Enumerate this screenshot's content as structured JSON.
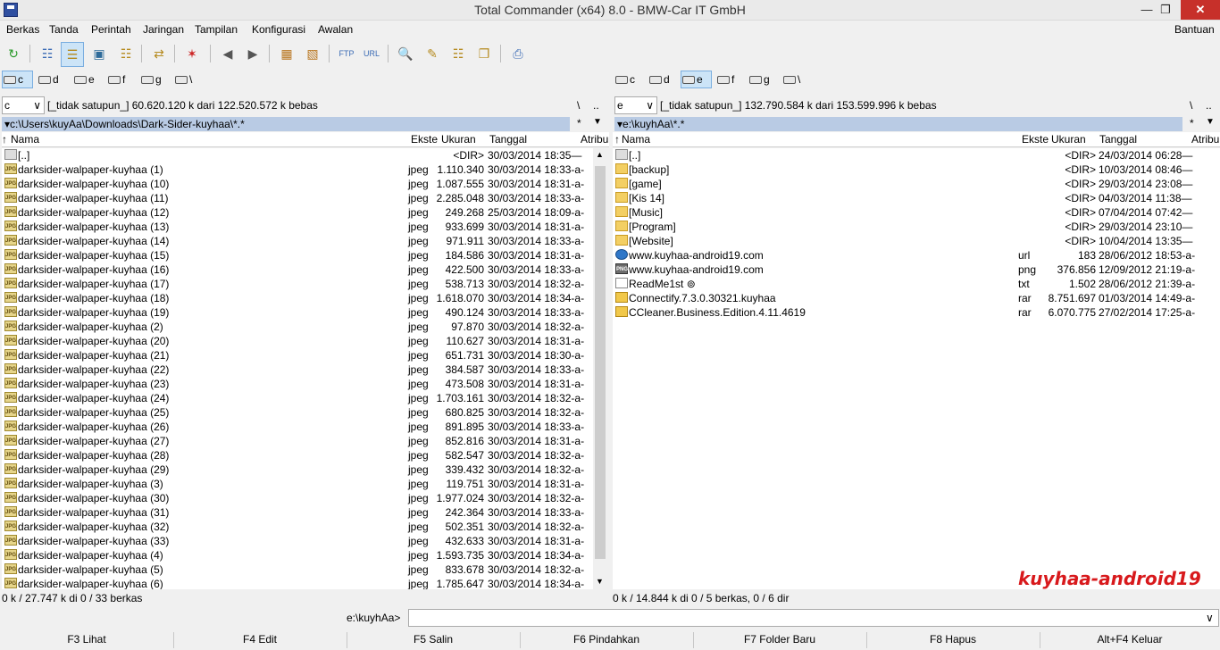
{
  "window": {
    "title": "Total Commander (x64) 8.0 - BMW-Car IT GmbH",
    "min": "—",
    "max": "❐",
    "close": "✕"
  },
  "menu": {
    "items": [
      "Berkas",
      "Tanda",
      "Perintah",
      "Jaringan",
      "Tampilan",
      "Konfigurasi",
      "Awalan"
    ],
    "help": "Bantuan"
  },
  "left": {
    "drives": [
      "c",
      "d",
      "e",
      "f",
      "g",
      "\\"
    ],
    "active_drive": "c",
    "combo": "c",
    "info": "[_tidak satupun_]  60.620.120 k dari 122.520.572 k bebas",
    "root_btn": "\\",
    "parent_btn": "..",
    "path": "c:\\Users\\kuyAa\\Downloads\\Dark-Sider-kuyhaa\\*.*",
    "star": "*",
    "cols": {
      "name": "Nama",
      "ext": "Ekste",
      "size": "Ukuran",
      "date": "Tanggal",
      "attr": "Atribu"
    },
    "rows": [
      {
        "icon": "up",
        "name": "[..]",
        "ext": "",
        "size": "<DIR>",
        "date": "30/03/2014 18:35—"
      },
      {
        "icon": "jpg",
        "name": "darksider-walpaper-kuyhaa (1)",
        "ext": "jpeg",
        "size": "1.110.340",
        "date": "30/03/2014 18:33-a-"
      },
      {
        "icon": "jpg",
        "name": "darksider-walpaper-kuyhaa (10)",
        "ext": "jpeg",
        "size": "1.087.555",
        "date": "30/03/2014 18:31-a-"
      },
      {
        "icon": "jpg",
        "name": "darksider-walpaper-kuyhaa (11)",
        "ext": "jpeg",
        "size": "2.285.048",
        "date": "30/03/2014 18:33-a-"
      },
      {
        "icon": "jpg",
        "name": "darksider-walpaper-kuyhaa (12)",
        "ext": "jpeg",
        "size": "249.268",
        "date": "25/03/2014 18:09-a-"
      },
      {
        "icon": "jpg",
        "name": "darksider-walpaper-kuyhaa (13)",
        "ext": "jpeg",
        "size": "933.699",
        "date": "30/03/2014 18:31-a-"
      },
      {
        "icon": "jpg",
        "name": "darksider-walpaper-kuyhaa (14)",
        "ext": "jpeg",
        "size": "971.911",
        "date": "30/03/2014 18:33-a-"
      },
      {
        "icon": "jpg",
        "name": "darksider-walpaper-kuyhaa (15)",
        "ext": "jpeg",
        "size": "184.586",
        "date": "30/03/2014 18:31-a-"
      },
      {
        "icon": "jpg",
        "name": "darksider-walpaper-kuyhaa (16)",
        "ext": "jpeg",
        "size": "422.500",
        "date": "30/03/2014 18:33-a-"
      },
      {
        "icon": "jpg",
        "name": "darksider-walpaper-kuyhaa (17)",
        "ext": "jpeg",
        "size": "538.713",
        "date": "30/03/2014 18:32-a-"
      },
      {
        "icon": "jpg",
        "name": "darksider-walpaper-kuyhaa (18)",
        "ext": "jpeg",
        "size": "1.618.070",
        "date": "30/03/2014 18:34-a-"
      },
      {
        "icon": "jpg",
        "name": "darksider-walpaper-kuyhaa (19)",
        "ext": "jpeg",
        "size": "490.124",
        "date": "30/03/2014 18:33-a-"
      },
      {
        "icon": "jpg",
        "name": "darksider-walpaper-kuyhaa (2)",
        "ext": "jpeg",
        "size": "97.870",
        "date": "30/03/2014 18:32-a-"
      },
      {
        "icon": "jpg",
        "name": "darksider-walpaper-kuyhaa (20)",
        "ext": "jpeg",
        "size": "110.627",
        "date": "30/03/2014 18:31-a-"
      },
      {
        "icon": "jpg",
        "name": "darksider-walpaper-kuyhaa (21)",
        "ext": "jpeg",
        "size": "651.731",
        "date": "30/03/2014 18:30-a-"
      },
      {
        "icon": "jpg",
        "name": "darksider-walpaper-kuyhaa (22)",
        "ext": "jpeg",
        "size": "384.587",
        "date": "30/03/2014 18:33-a-"
      },
      {
        "icon": "jpg",
        "name": "darksider-walpaper-kuyhaa (23)",
        "ext": "jpeg",
        "size": "473.508",
        "date": "30/03/2014 18:31-a-"
      },
      {
        "icon": "jpg",
        "name": "darksider-walpaper-kuyhaa (24)",
        "ext": "jpeg",
        "size": "1.703.161",
        "date": "30/03/2014 18:32-a-"
      },
      {
        "icon": "jpg",
        "name": "darksider-walpaper-kuyhaa (25)",
        "ext": "jpeg",
        "size": "680.825",
        "date": "30/03/2014 18:32-a-"
      },
      {
        "icon": "jpg",
        "name": "darksider-walpaper-kuyhaa (26)",
        "ext": "jpeg",
        "size": "891.895",
        "date": "30/03/2014 18:33-a-"
      },
      {
        "icon": "jpg",
        "name": "darksider-walpaper-kuyhaa (27)",
        "ext": "jpeg",
        "size": "852.816",
        "date": "30/03/2014 18:31-a-"
      },
      {
        "icon": "jpg",
        "name": "darksider-walpaper-kuyhaa (28)",
        "ext": "jpeg",
        "size": "582.547",
        "date": "30/03/2014 18:32-a-"
      },
      {
        "icon": "jpg",
        "name": "darksider-walpaper-kuyhaa (29)",
        "ext": "jpeg",
        "size": "339.432",
        "date": "30/03/2014 18:32-a-"
      },
      {
        "icon": "jpg",
        "name": "darksider-walpaper-kuyhaa (3)",
        "ext": "jpeg",
        "size": "119.751",
        "date": "30/03/2014 18:31-a-"
      },
      {
        "icon": "jpg",
        "name": "darksider-walpaper-kuyhaa (30)",
        "ext": "jpeg",
        "size": "1.977.024",
        "date": "30/03/2014 18:32-a-"
      },
      {
        "icon": "jpg",
        "name": "darksider-walpaper-kuyhaa (31)",
        "ext": "jpeg",
        "size": "242.364",
        "date": "30/03/2014 18:33-a-"
      },
      {
        "icon": "jpg",
        "name": "darksider-walpaper-kuyhaa (32)",
        "ext": "jpeg",
        "size": "502.351",
        "date": "30/03/2014 18:32-a-"
      },
      {
        "icon": "jpg",
        "name": "darksider-walpaper-kuyhaa (33)",
        "ext": "jpeg",
        "size": "432.633",
        "date": "30/03/2014 18:31-a-"
      },
      {
        "icon": "jpg",
        "name": "darksider-walpaper-kuyhaa (4)",
        "ext": "jpeg",
        "size": "1.593.735",
        "date": "30/03/2014 18:34-a-"
      },
      {
        "icon": "jpg",
        "name": "darksider-walpaper-kuyhaa (5)",
        "ext": "jpeg",
        "size": "833.678",
        "date": "30/03/2014 18:32-a-"
      },
      {
        "icon": "jpg",
        "name": "darksider-walpaper-kuyhaa (6)",
        "ext": "jpeg",
        "size": "1.785.647",
        "date": "30/03/2014 18:34-a-"
      }
    ],
    "status": "0 k / 27.747 k di 0 / 33 berkas"
  },
  "right": {
    "drives": [
      "c",
      "d",
      "e",
      "f",
      "g",
      "\\"
    ],
    "active_drive": "e",
    "combo": "e",
    "info": "[_tidak satupun_]  132.790.584 k dari 153.599.996 k bebas",
    "root_btn": "\\",
    "parent_btn": "..",
    "path": "e:\\kuyhAa\\*.*",
    "star": "*",
    "cols": {
      "name": "Nama",
      "ext": "Ekste",
      "size": "Ukuran",
      "date": "Tanggal",
      "attr": "Atribu"
    },
    "rows": [
      {
        "icon": "up",
        "name": "[..]",
        "ext": "",
        "size": "<DIR>",
        "date": "24/03/2014 06:28—"
      },
      {
        "icon": "folder",
        "name": "[backup]",
        "ext": "",
        "size": "<DIR>",
        "date": "10/03/2014 08:46—"
      },
      {
        "icon": "folder",
        "name": "[game]",
        "ext": "",
        "size": "<DIR>",
        "date": "29/03/2014 23:08—"
      },
      {
        "icon": "folder",
        "name": "[Kis 14]",
        "ext": "",
        "size": "<DIR>",
        "date": "04/03/2014 11:38—"
      },
      {
        "icon": "folder",
        "name": "[Music]",
        "ext": "",
        "size": "<DIR>",
        "date": "07/04/2014 07:42—"
      },
      {
        "icon": "folder",
        "name": "[Program]",
        "ext": "",
        "size": "<DIR>",
        "date": "29/03/2014 23:10—"
      },
      {
        "icon": "folder",
        "name": "[Website]",
        "ext": "",
        "size": "<DIR>",
        "date": "10/04/2014 13:35—"
      },
      {
        "icon": "web",
        "name": "www.kuyhaa-android19.com",
        "ext": "url",
        "size": "183",
        "date": "28/06/2012 18:53-a-"
      },
      {
        "icon": "png",
        "name": "www.kuyhaa-android19.com",
        "ext": "png",
        "size": "376.856",
        "date": "12/09/2012 21:19-a-"
      },
      {
        "icon": "txt",
        "name": "ReadMe1st ⊚",
        "ext": "txt",
        "size": "1.502",
        "date": "28/06/2012 21:39-a-"
      },
      {
        "icon": "rar",
        "name": "Connectify.7.3.0.30321.kuyhaa",
        "ext": "rar",
        "size": "8.751.697",
        "date": "01/03/2014 14:49-a-"
      },
      {
        "icon": "rar",
        "name": "CCleaner.Business.Edition.4.11.4619",
        "ext": "rar",
        "size": "6.070.775",
        "date": "27/02/2014 17:25-a-"
      }
    ],
    "status": "0 k / 14.844 k di 0 / 5 berkas, 0 / 6 dir"
  },
  "cmd": {
    "label": "e:\\kuyhAa>",
    "value": ""
  },
  "fkeys": [
    "F3 Lihat",
    "F4 Edit",
    "F5 Salin",
    "F6 Pindahkan",
    "F7 Folder Baru",
    "F8 Hapus",
    "Alt+F4 Keluar"
  ],
  "watermark": "kuyhaa-android19",
  "toolbar": [
    "refresh-icon",
    "brief-view-icon",
    "detailed-view-icon",
    "thumbnail-view-icon",
    "tree-view-icon",
    "sync-dirs-icon",
    "invert-selection-icon",
    "back-icon",
    "forward-icon",
    "pack-icon",
    "unpack-icon",
    "ftp-icon",
    "url-icon",
    "find-icon",
    "rename-icon",
    "compare-icon",
    "multi-rename-icon",
    "notepad-icon"
  ],
  "colors": {
    "path_bar": "#b9cbe4",
    "watermark": "#d8191c",
    "close": "#c7302a"
  }
}
